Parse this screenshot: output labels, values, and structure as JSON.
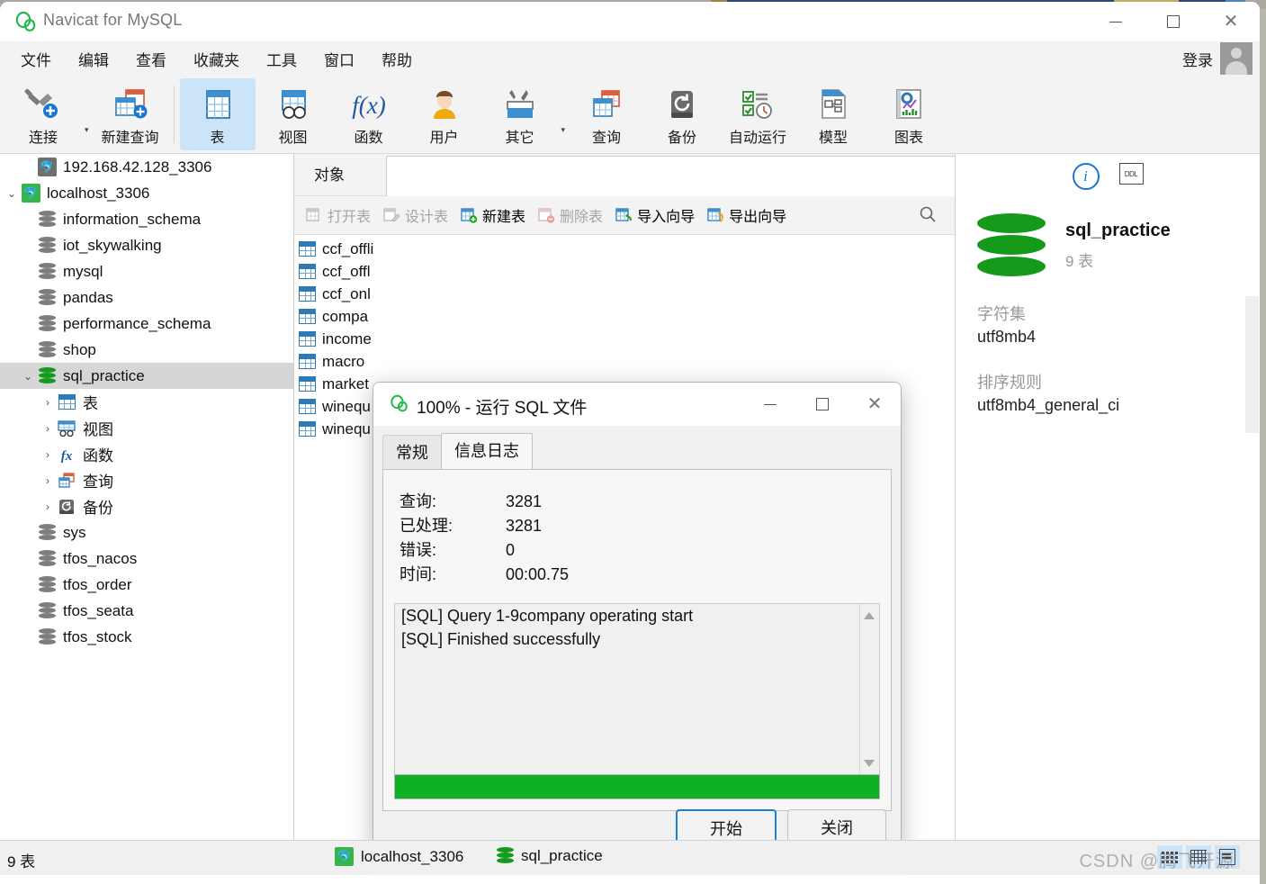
{
  "app": {
    "title": "Navicat for MySQL",
    "logo_icon": "navicat-logo-icon"
  },
  "window_controls": {
    "minimize": "minimize-icon",
    "maximize": "maximize-icon",
    "close": "close-icon"
  },
  "menubar": {
    "items": [
      {
        "label": "文件"
      },
      {
        "label": "编辑"
      },
      {
        "label": "查看"
      },
      {
        "label": "收藏夹"
      },
      {
        "label": "工具"
      },
      {
        "label": "窗口"
      },
      {
        "label": "帮助"
      }
    ],
    "login_label": "登录"
  },
  "toolbar": {
    "items": [
      {
        "label": "连接",
        "icon": "connection-icon",
        "has_caret": true,
        "active": false
      },
      {
        "label": "新建查询",
        "icon": "new-query-icon",
        "has_caret": false,
        "active": false
      },
      {
        "label": "表",
        "icon": "table-icon",
        "has_caret": false,
        "active": true
      },
      {
        "label": "视图",
        "icon": "view-icon",
        "has_caret": false,
        "active": false
      },
      {
        "label": "函数",
        "icon": "function-icon",
        "has_caret": false,
        "active": false
      },
      {
        "label": "用户",
        "icon": "user-icon",
        "has_caret": false,
        "active": false
      },
      {
        "label": "其它",
        "icon": "other-icon",
        "has_caret": true,
        "active": false
      },
      {
        "label": "查询",
        "icon": "query-icon",
        "has_caret": false,
        "active": false
      },
      {
        "label": "备份",
        "icon": "backup-icon",
        "has_caret": false,
        "active": false
      },
      {
        "label": "自动运行",
        "icon": "automation-icon",
        "has_caret": false,
        "active": false
      },
      {
        "label": "模型",
        "icon": "model-icon",
        "has_caret": false,
        "active": false
      },
      {
        "label": "图表",
        "icon": "chart-icon",
        "has_caret": false,
        "active": false
      }
    ]
  },
  "sidebar": {
    "nodes": [
      {
        "label": "192.168.42.128_3306",
        "icon": "mysql-connection-icon",
        "indent": 1,
        "expander": "none",
        "state": "closed",
        "kind": "conn-grey",
        "selected": false
      },
      {
        "label": "localhost_3306",
        "icon": "mysql-connection-icon",
        "indent": 0,
        "expander": "down",
        "state": "open",
        "kind": "conn-green",
        "selected": false
      },
      {
        "label": "information_schema",
        "icon": "database-icon",
        "indent": 2,
        "expander": "none",
        "kind": "db-grey",
        "selected": false
      },
      {
        "label": "iot_skywalking",
        "icon": "database-icon",
        "indent": 2,
        "expander": "none",
        "kind": "db-grey",
        "selected": false
      },
      {
        "label": "mysql",
        "icon": "database-icon",
        "indent": 2,
        "expander": "none",
        "kind": "db-grey",
        "selected": false
      },
      {
        "label": "pandas",
        "icon": "database-icon",
        "indent": 2,
        "expander": "none",
        "kind": "db-grey",
        "selected": false
      },
      {
        "label": "performance_schema",
        "icon": "database-icon",
        "indent": 2,
        "expander": "none",
        "kind": "db-grey",
        "selected": false
      },
      {
        "label": "shop",
        "icon": "database-icon",
        "indent": 2,
        "expander": "none",
        "kind": "db-grey",
        "selected": false
      },
      {
        "label": "sql_practice",
        "icon": "database-icon",
        "indent": 1,
        "expander": "down",
        "kind": "db-green",
        "selected": true
      },
      {
        "label": "表",
        "icon": "table-icon",
        "indent": 2,
        "expander": "right",
        "kind": "folder-table",
        "selected": false
      },
      {
        "label": "视图",
        "icon": "view-icon",
        "indent": 2,
        "expander": "right",
        "kind": "folder-view",
        "selected": false
      },
      {
        "label": "函数",
        "icon": "function-icon",
        "indent": 2,
        "expander": "right",
        "kind": "folder-func",
        "selected": false
      },
      {
        "label": "查询",
        "icon": "query-icon",
        "indent": 2,
        "expander": "right",
        "kind": "folder-query",
        "selected": false
      },
      {
        "label": "备份",
        "icon": "backup-icon",
        "indent": 2,
        "expander": "right",
        "kind": "folder-backup",
        "selected": false
      },
      {
        "label": "sys",
        "icon": "database-icon",
        "indent": 2,
        "expander": "none",
        "kind": "db-grey",
        "selected": false
      },
      {
        "label": "tfos_nacos",
        "icon": "database-icon",
        "indent": 2,
        "expander": "none",
        "kind": "db-grey",
        "selected": false
      },
      {
        "label": "tfos_order",
        "icon": "database-icon",
        "indent": 2,
        "expander": "none",
        "kind": "db-grey",
        "selected": false
      },
      {
        "label": "tfos_seata",
        "icon": "database-icon",
        "indent": 2,
        "expander": "none",
        "kind": "db-grey",
        "selected": false
      },
      {
        "label": "tfos_stock",
        "icon": "database-icon",
        "indent": 2,
        "expander": "none",
        "kind": "db-grey",
        "selected": false
      }
    ]
  },
  "main": {
    "object_tab_label": "对象",
    "search_value": "",
    "actions": [
      {
        "label": "打开表",
        "icon": "open-table-icon",
        "disabled": true
      },
      {
        "label": "设计表",
        "icon": "design-table-icon",
        "disabled": true
      },
      {
        "label": "新建表",
        "icon": "new-table-icon",
        "disabled": false
      },
      {
        "label": "删除表",
        "icon": "delete-table-icon",
        "disabled": true
      },
      {
        "label": "导入向导",
        "icon": "import-wizard-icon",
        "disabled": false
      },
      {
        "label": "导出向导",
        "icon": "export-wizard-icon",
        "disabled": false
      }
    ],
    "search_icon": "search-icon",
    "tables": [
      {
        "name": "ccf_offli"
      },
      {
        "name": "ccf_offl"
      },
      {
        "name": "ccf_onl"
      },
      {
        "name": "compa"
      },
      {
        "name": "income"
      },
      {
        "name": "macro"
      },
      {
        "name": "market"
      },
      {
        "name": "winequ"
      },
      {
        "name": "winequ"
      }
    ]
  },
  "info_panel": {
    "info_icon": "info-icon",
    "ddl_icon": "ddl-icon",
    "db_icon": "database-icon",
    "db_name": "sql_practice",
    "table_count": "9 表",
    "fields": [
      {
        "label": "字符集",
        "value": "utf8mb4"
      },
      {
        "label": "排序规则",
        "value": "utf8mb4_general_ci"
      }
    ]
  },
  "statusbar": {
    "left_text": "9 表",
    "connection": "localhost_3306",
    "database": "sql_practice",
    "connection_icon": "mysql-connection-icon",
    "database_icon": "database-icon",
    "view_buttons": [
      {
        "icon": "list-view-icon"
      },
      {
        "icon": "grid-view-icon"
      },
      {
        "icon": "form-view-icon"
      }
    ],
    "watermark": "CSDN @腾飞开源"
  },
  "dialog": {
    "logo_icon": "navicat-logo-icon",
    "title": "100% - 运行 SQL 文件",
    "minimize_icon": "minimize-icon",
    "maximize_icon": "maximize-icon",
    "close_icon": "close-icon",
    "tabs": [
      {
        "label": "常规",
        "active": false
      },
      {
        "label": "信息日志",
        "active": true
      }
    ],
    "stats": [
      {
        "label": "查询:",
        "value": "3281"
      },
      {
        "label": "已处理:",
        "value": "3281"
      },
      {
        "label": "错误:",
        "value": "0"
      },
      {
        "label": "时间:",
        "value": "00:00.75"
      }
    ],
    "log_lines": [
      "[SQL] Query 1-9company operating start",
      "[SQL] Finished successfully"
    ],
    "scroll_up_icon": "scroll-up-icon",
    "scroll_down_icon": "scroll-down-icon",
    "progress_percent": 100,
    "buttons": [
      {
        "label": "开始",
        "primary": true
      },
      {
        "label": "关闭",
        "primary": false
      }
    ]
  },
  "colors": {
    "accent_blue": "#1878d1",
    "green": "#0fb026",
    "db_green": "#169a1c",
    "selection": "#cce4f7"
  }
}
